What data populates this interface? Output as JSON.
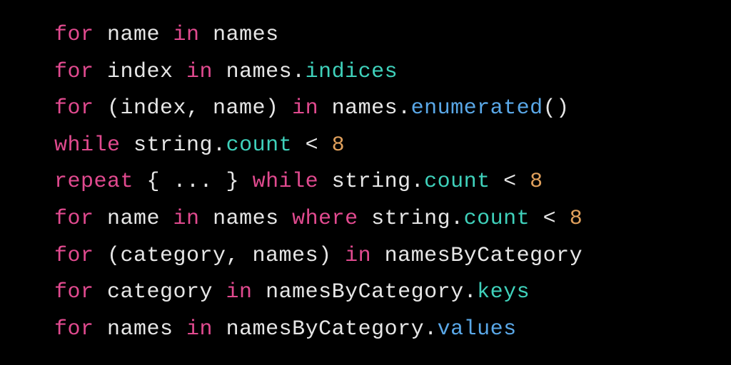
{
  "code": {
    "lines": [
      {
        "tokens": [
          {
            "text": "for",
            "cls": "t-keyword"
          },
          {
            "text": " name ",
            "cls": "t-default"
          },
          {
            "text": "in",
            "cls": "t-keyword"
          },
          {
            "text": " names",
            "cls": "t-default"
          }
        ]
      },
      {
        "tokens": [
          {
            "text": "for",
            "cls": "t-keyword"
          },
          {
            "text": " index ",
            "cls": "t-default"
          },
          {
            "text": "in",
            "cls": "t-keyword"
          },
          {
            "text": " names",
            "cls": "t-default"
          },
          {
            "text": ".",
            "cls": "t-punct"
          },
          {
            "text": "indices",
            "cls": "t-property"
          }
        ]
      },
      {
        "tokens": [
          {
            "text": "for",
            "cls": "t-keyword"
          },
          {
            "text": " (index, name) ",
            "cls": "t-default"
          },
          {
            "text": "in",
            "cls": "t-keyword"
          },
          {
            "text": " names",
            "cls": "t-default"
          },
          {
            "text": ".",
            "cls": "t-punct"
          },
          {
            "text": "enumerated",
            "cls": "t-method"
          },
          {
            "text": "()",
            "cls": "t-punct"
          }
        ]
      },
      {
        "tokens": [
          {
            "text": "while",
            "cls": "t-keyword"
          },
          {
            "text": " string",
            "cls": "t-default"
          },
          {
            "text": ".",
            "cls": "t-punct"
          },
          {
            "text": "count",
            "cls": "t-property"
          },
          {
            "text": " < ",
            "cls": "t-default"
          },
          {
            "text": "8",
            "cls": "t-number"
          }
        ]
      },
      {
        "tokens": [
          {
            "text": "repeat",
            "cls": "t-keyword"
          },
          {
            "text": " { ... } ",
            "cls": "t-default"
          },
          {
            "text": "while",
            "cls": "t-keyword"
          },
          {
            "text": " string",
            "cls": "t-default"
          },
          {
            "text": ".",
            "cls": "t-punct"
          },
          {
            "text": "count",
            "cls": "t-property"
          },
          {
            "text": " < ",
            "cls": "t-default"
          },
          {
            "text": "8",
            "cls": "t-number"
          }
        ]
      },
      {
        "tokens": [
          {
            "text": "for",
            "cls": "t-keyword"
          },
          {
            "text": " name ",
            "cls": "t-default"
          },
          {
            "text": "in",
            "cls": "t-keyword"
          },
          {
            "text": " names ",
            "cls": "t-default"
          },
          {
            "text": "where",
            "cls": "t-keyword"
          },
          {
            "text": " string",
            "cls": "t-default"
          },
          {
            "text": ".",
            "cls": "t-punct"
          },
          {
            "text": "count",
            "cls": "t-property"
          },
          {
            "text": " < ",
            "cls": "t-default"
          },
          {
            "text": "8",
            "cls": "t-number"
          }
        ]
      },
      {
        "tokens": [
          {
            "text": "for",
            "cls": "t-keyword"
          },
          {
            "text": " (category, names) ",
            "cls": "t-default"
          },
          {
            "text": "in",
            "cls": "t-keyword"
          },
          {
            "text": " namesByCategory",
            "cls": "t-default"
          }
        ]
      },
      {
        "tokens": [
          {
            "text": "for",
            "cls": "t-keyword"
          },
          {
            "text": " category ",
            "cls": "t-default"
          },
          {
            "text": "in",
            "cls": "t-keyword"
          },
          {
            "text": " namesByCategory",
            "cls": "t-default"
          },
          {
            "text": ".",
            "cls": "t-punct"
          },
          {
            "text": "keys",
            "cls": "t-property"
          }
        ]
      },
      {
        "tokens": [
          {
            "text": "for",
            "cls": "t-keyword"
          },
          {
            "text": " names ",
            "cls": "t-default"
          },
          {
            "text": "in",
            "cls": "t-keyword"
          },
          {
            "text": " namesByCategory",
            "cls": "t-default"
          },
          {
            "text": ".",
            "cls": "t-punct"
          },
          {
            "text": "values",
            "cls": "t-method"
          }
        ]
      }
    ]
  }
}
